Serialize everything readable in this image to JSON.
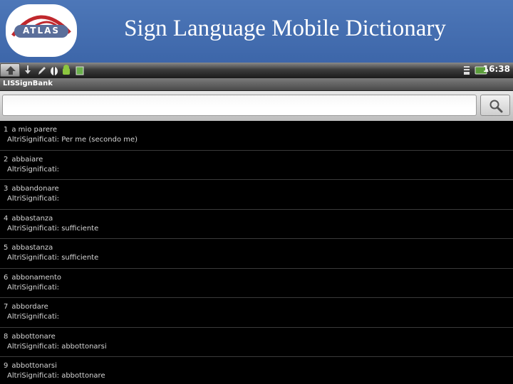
{
  "slide": {
    "title": "Sign Language Mobile Dictionary",
    "logo_text": "ATLAS"
  },
  "status_bar": {
    "time": "16:38",
    "icons": [
      "home-button",
      "download-icon",
      "edit-icon",
      "android-debug-icon",
      "android-icon",
      "sd-card-icon",
      "signal-icon",
      "battery-icon"
    ]
  },
  "app": {
    "title": "LISSignBank"
  },
  "search": {
    "value": "",
    "placeholder": ""
  },
  "colors": {
    "slide_header": "#4472b5",
    "list_background": "#000000",
    "list_text": "#d6d6d6",
    "divider": "#3a3a3a"
  },
  "results": [
    {
      "number": "1",
      "word": "a mio parere",
      "meaning": "AltriSignificati: Per me (secondo me)"
    },
    {
      "number": "2",
      "word": "abbaiare",
      "meaning": "AltriSignificati:"
    },
    {
      "number": "3",
      "word": "abbandonare",
      "meaning": "AltriSignificati:"
    },
    {
      "number": "4",
      "word": "abbastanza",
      "meaning": "AltriSignificati: sufficiente"
    },
    {
      "number": "5",
      "word": "abbastanza",
      "meaning": "AltriSignificati: sufficiente"
    },
    {
      "number": "6",
      "word": "abbonamento",
      "meaning": "AltriSignificati:"
    },
    {
      "number": "7",
      "word": "abbordare",
      "meaning": "AltriSignificati:"
    },
    {
      "number": "8",
      "word": "abbottonare",
      "meaning": "AltriSignificati: abbottonarsi"
    },
    {
      "number": "9",
      "word": "abbottonarsi",
      "meaning": "AltriSignificati: abbottonare"
    }
  ]
}
